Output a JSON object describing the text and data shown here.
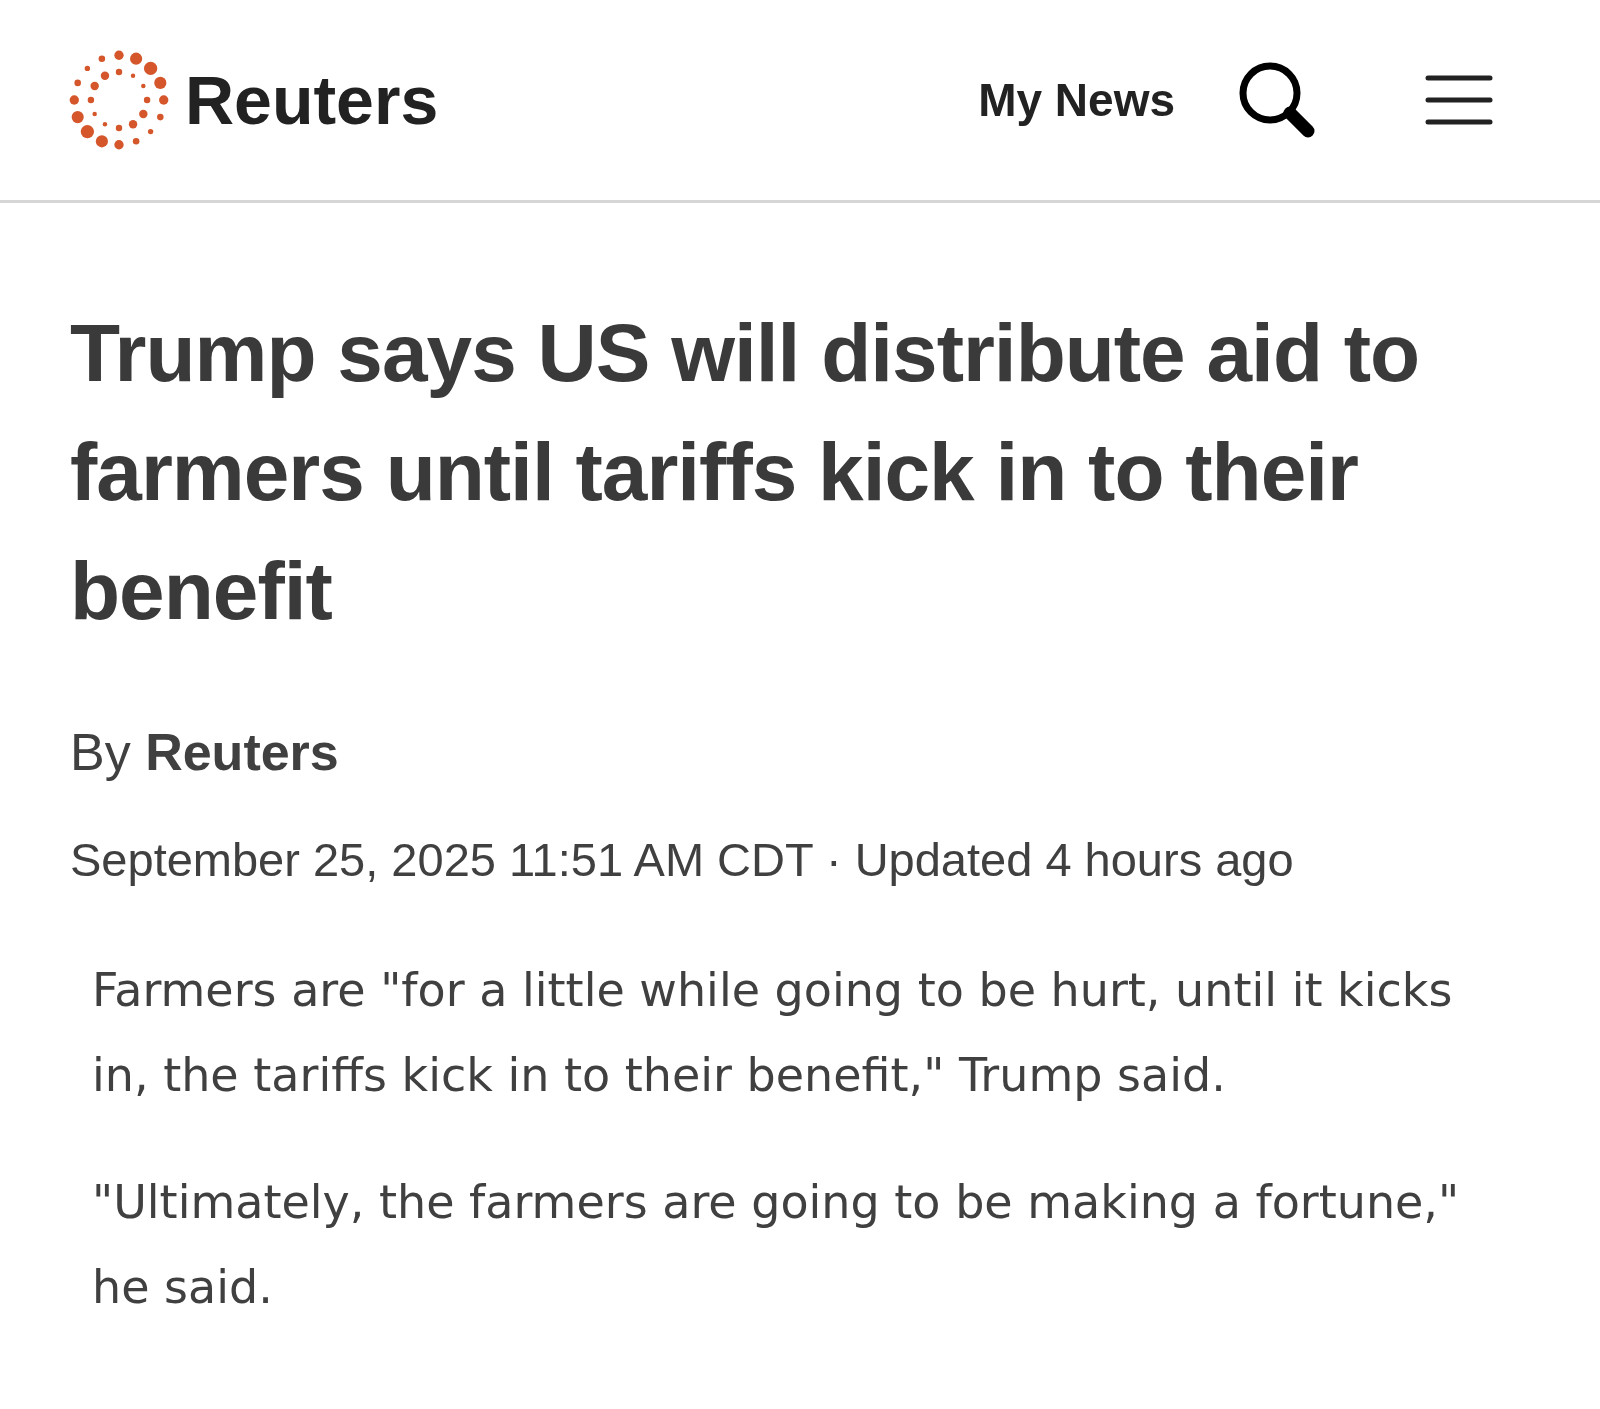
{
  "header": {
    "logo_text": "Reuters",
    "nav_link": "My News"
  },
  "article": {
    "headline": "Trump says US will distribute aid to farmers until tariffs kick in to their benefit",
    "byline": "By **Reuters**",
    "dateline": "September 25, 2025 11:51 AM CDT · Updated 4 hours ago",
    "paragraphs": [
      "Farmers are \"for a little while going to be hurt, until it kicks in, the tariffs kick in to their benefit,\" Trump said.",
      "\"Ultimately, the farmers are going to be making a fortune,\" he said."
    ]
  }
}
